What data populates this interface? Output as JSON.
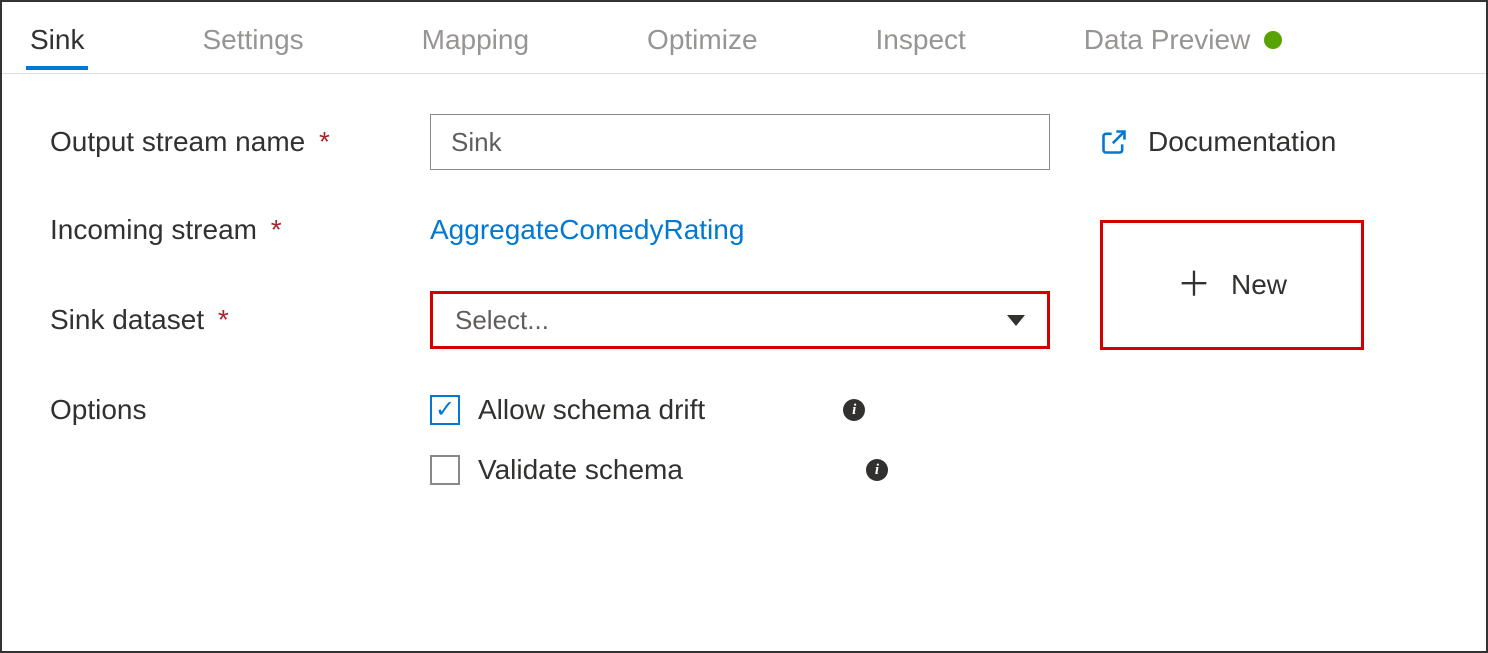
{
  "tabs": {
    "sink": "Sink",
    "settings": "Settings",
    "mapping": "Mapping",
    "optimize": "Optimize",
    "inspect": "Inspect",
    "dataPreview": "Data Preview"
  },
  "form": {
    "outputStreamName": {
      "label": "Output stream name",
      "value": "Sink"
    },
    "incomingStream": {
      "label": "Incoming stream",
      "value": "AggregateComedyRating"
    },
    "sinkDataset": {
      "label": "Sink dataset",
      "placeholder": "Select..."
    },
    "options": {
      "label": "Options",
      "allowSchemaDrift": {
        "label": "Allow schema drift",
        "checked": true
      },
      "validateSchema": {
        "label": "Validate schema",
        "checked": false
      }
    }
  },
  "actions": {
    "documentation": "Documentation",
    "new": "New"
  }
}
